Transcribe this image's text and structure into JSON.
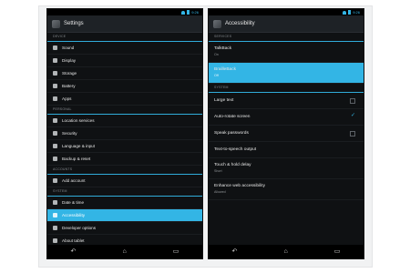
{
  "left": {
    "title": "Settings",
    "sections": [
      {
        "header": "DEVICE",
        "items": [
          "Sound",
          "Display",
          "Storage",
          "Battery",
          "Apps"
        ]
      },
      {
        "header": "PERSONAL",
        "items": [
          "Location services",
          "Security",
          "Language & input",
          "Backup & reset"
        ]
      },
      {
        "header": "ACCOUNTS",
        "items": [
          "Add account"
        ]
      },
      {
        "header": "SYSTEM",
        "items": [
          "Date & time",
          "Accessibility",
          "Developer options",
          "About tablet"
        ]
      }
    ]
  },
  "right": {
    "title": "Accessibility",
    "services_header": "SERVICES",
    "talkback": {
      "label": "TalkBack",
      "sub": "On"
    },
    "brailleback": {
      "label": "BrailleBack",
      "sub": "Off"
    },
    "system_header": "SYSTEM",
    "large_text": "Large text",
    "auto_rotate": "Auto-rotate screen",
    "speak_passwords": "Speak passwords",
    "tts": "Text-to-speech output",
    "touch_hold": {
      "label": "Touch & hold delay",
      "sub": "Short"
    },
    "enhance_web": {
      "label": "Enhance web accessibility",
      "sub": "Allowed"
    }
  },
  "status": {
    "time": "9:26"
  },
  "nav": {
    "back": "↶",
    "home": "⌂",
    "recent": "▭"
  }
}
